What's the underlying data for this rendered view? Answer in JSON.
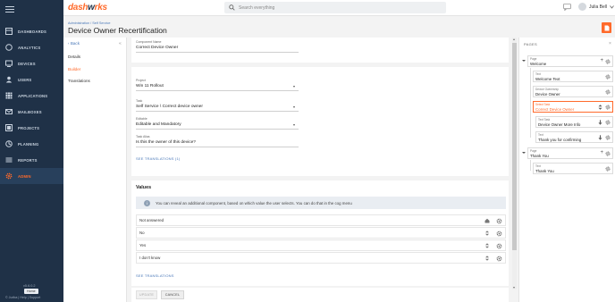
{
  "colors": {
    "brand": "#ff6a2b",
    "sidebar": "#1f3147",
    "link": "#4a78b8"
  },
  "sidebar": {
    "items": [
      {
        "label": "DASHBOARDS",
        "icon": "dashboard-icon"
      },
      {
        "label": "ANALYTICS",
        "icon": "analytics-icon"
      },
      {
        "label": "DEVICES",
        "icon": "devices-icon"
      },
      {
        "label": "USERS",
        "icon": "users-icon"
      },
      {
        "label": "APPLICATIONS",
        "icon": "applications-icon"
      },
      {
        "label": "MAILBOXES",
        "icon": "mailbox-icon"
      },
      {
        "label": "PROJECTS",
        "icon": "projects-icon"
      },
      {
        "label": "PLANNING",
        "icon": "planning-icon"
      },
      {
        "label": "REPORTS",
        "icon": "reports-icon"
      },
      {
        "label": "ADMIN",
        "icon": "gear-icon"
      }
    ],
    "active_index": 9,
    "version": "v5.6.0.2",
    "tooltip": "Home",
    "footer": "© Juriba | Help | Support"
  },
  "topbar": {
    "logo_a": "dash",
    "logo_b": "w",
    "logo_c": "rks",
    "search_placeholder": "Search everything",
    "user_name": "Julia Bell"
  },
  "breadcrumb": {
    "parent": "Administration",
    "current": "Self Service"
  },
  "page_title": "Device Owner Recertification",
  "leftnav": {
    "back": "Back",
    "items": [
      "Details",
      "Builder",
      "Translations"
    ],
    "active_index": 1
  },
  "component": {
    "label": "Component Name",
    "value": "Correct Device Owner"
  },
  "fields": [
    {
      "label": "Project",
      "value": "Win 11 Rollout"
    },
    {
      "label": "Task",
      "value": "Self Service \\ Correct device owner"
    },
    {
      "label": "Editable",
      "value": "Editable and Mandatory"
    },
    {
      "label": "Task Alias",
      "value": "Is this the owner of this device?"
    }
  ],
  "see_translations_count": "SEE TRANSLATIONS (1)",
  "values": {
    "title": "Values",
    "info": "You can reveal an additional component, based on which value the user selects. You can do that in the cog menu",
    "rows": [
      "Not answered",
      "No",
      "Yes",
      "I don't know"
    ],
    "see_translations": "SEE TRANSLATIONS"
  },
  "buttons": {
    "update": "UPDATE",
    "cancel": "CANCEL"
  },
  "pages": {
    "title": "PAGES",
    "page1": {
      "label": "Page",
      "value": "Welcome"
    },
    "page1_children": [
      {
        "label": "Text",
        "value": "Welcome Text"
      },
      {
        "label": "Device Ownership",
        "value": "Device Owner"
      },
      {
        "label": "Select Task",
        "value": "Correct Device Owner"
      },
      {
        "label": "Text Task",
        "value": "Device Owner More Info"
      },
      {
        "label": "Text",
        "value": "Thank you for confirming"
      }
    ],
    "page2": {
      "label": "Page",
      "value": "Thank You"
    },
    "page2_children": [
      {
        "label": "Text",
        "value": "Thank You"
      }
    ]
  }
}
